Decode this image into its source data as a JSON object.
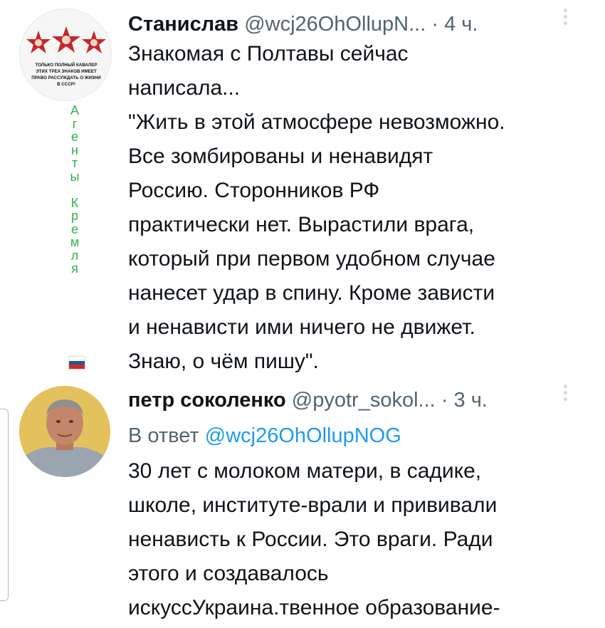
{
  "tweets": [
    {
      "author": "Станислав",
      "handle": "@wcj26OhOllupN...",
      "separator": "·",
      "time": "4 ч.",
      "avatar_text": [
        "ТОЛЬКО ПОЛНЫЙ КАВАЛЕР",
        "ЭТИХ ТРЕХ ЗНАКОВ ИМЕЕТ",
        "ПРАВО РАССУЖДАТЬ О ЖИЗНИ",
        "В СССР!"
      ],
      "thread_text": [
        "А",
        "г",
        "е",
        "н",
        "т",
        "ы",
        "",
        "К",
        "р",
        "е",
        "м",
        "л",
        "я"
      ],
      "lines": [
        "Знакомая с Полтавы сейчас",
        "написала...",
        "\"Жить в этой атмосфере невозможно.",
        "Все зомбированы и ненавидят",
        "Россию. Сторонников РФ",
        "практически нет. Вырастили врага,",
        "который при первом удобном случае",
        "нанесет удар в спину. Кроме зависти",
        "и ненависти ими ничего не движет.",
        "Знаю, о чём пишу\"."
      ]
    },
    {
      "author": "петр соколенко",
      "handle": "@pyotr_sokol...",
      "separator": "·",
      "time": "3 ч.",
      "reply_prefix": "В ответ",
      "reply_mention": "@wcj26OhOllupNOG",
      "lines": [
        "30 лет с молоком матери, в садике,",
        "школе, институте-врали и прививали",
        "ненависть к России. Это враги. Ради",
        "этого и создавалось",
        "искуссУкраина.твенное образование-"
      ]
    }
  ],
  "colors": {
    "text": "#0f1419",
    "secondary": "#536471",
    "link": "#1d9bf0",
    "thread_label": "#34b34a"
  },
  "icons": [
    "more-options-icon",
    "russian-flag-icon",
    "red-star-badge-icon"
  ]
}
